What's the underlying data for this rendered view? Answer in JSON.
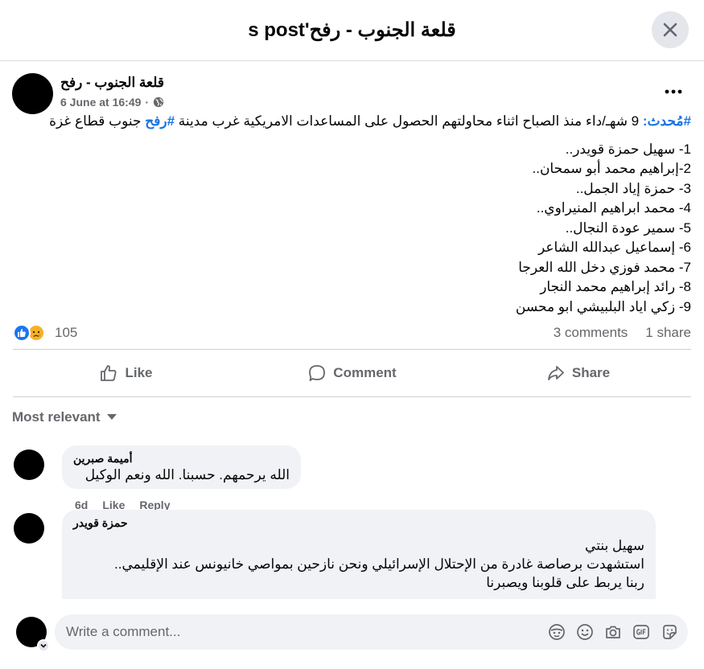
{
  "header": {
    "title": "قلعة الجنوب - رفح's post"
  },
  "post": {
    "author": "قلعة الجنوب - رفح",
    "date": "6 June at 16:49",
    "hashtag_1": "#مُحدث:",
    "intro_text": " 9 شهـ/داء منذ الصباح اثناء محاولتهم الحصول على المساعدات الامريكية غرب مدينة ",
    "hashtag_2": "#رفح",
    "intro_tail": " جنوب قطاع غزة",
    "list": [
      "1- سهيل حمزة قويدر..",
      "2-إبراهيم محمد أبو سمحان..",
      "3- حمزة إياد الجمل..",
      "4- محمد ابراهيم المنيراوي..",
      "5- سمير عودة النجال..",
      "6- إسماعيل عبدالله الشاعر",
      "7- محمد فوزي دخل الله العرجا",
      "8- رائد إبراهيم محمد النجار",
      "9- زكي اياد البلبيشي ابو محسن"
    ]
  },
  "stats": {
    "reactions": "105",
    "comments": "3 comments",
    "shares": "1 share"
  },
  "actions": {
    "like": "Like",
    "comment": "Comment",
    "share": "Share"
  },
  "sort_label": "Most relevant",
  "comments": [
    {
      "author": "أميمة صبرين",
      "text": "الله يرحمهم. حسبنا. الله ونعم الوكيل",
      "time": "6d",
      "like": "Like",
      "reply": "Reply"
    },
    {
      "author": "حمزة قويدر",
      "line1": "سهيل بنتي",
      "line2": "استشهدت برصاصة غادرة من الإحتلال الإسرائيلي ونحن نازحين بمواصي خانيونس عند الإقليمي..",
      "line3": "ربنا يربط على قلوبنا ويصبرنا"
    }
  ],
  "composer": {
    "placeholder": "Write a comment..."
  }
}
